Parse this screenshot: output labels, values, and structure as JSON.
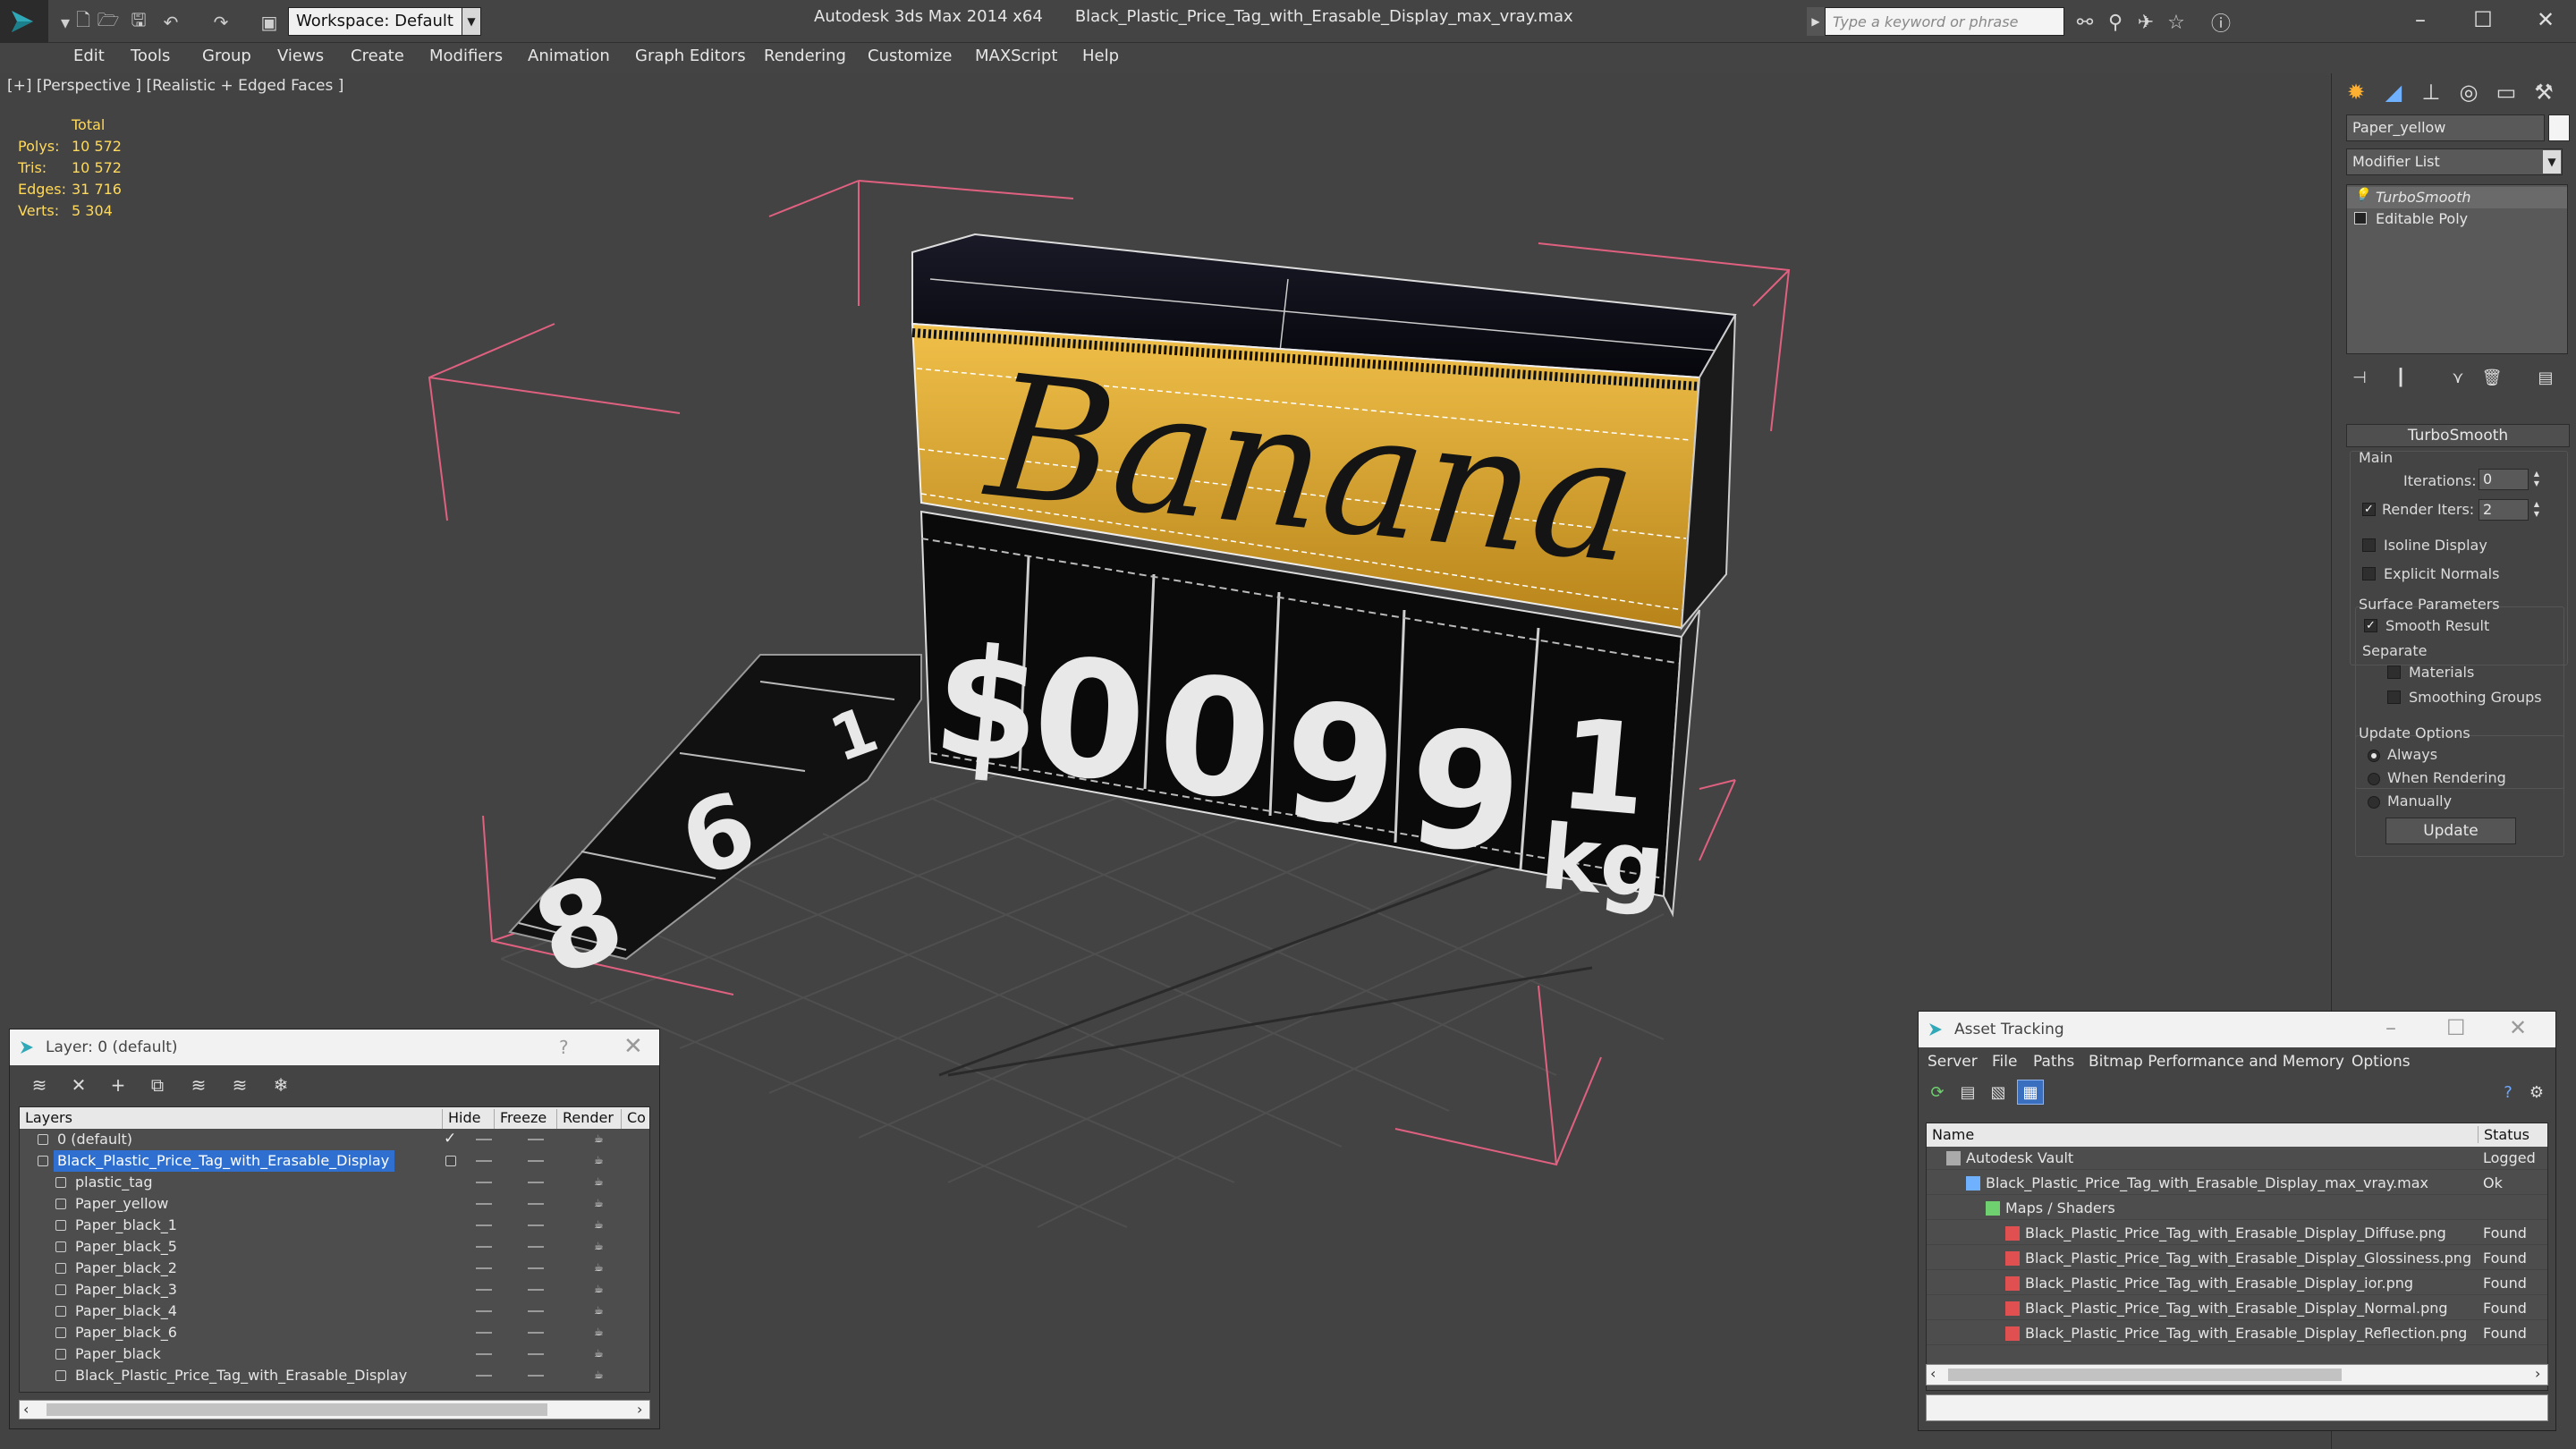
{
  "titlebar": {
    "app_title": "Autodesk 3ds Max  2014 x64",
    "file_title": "Black_Plastic_Price_Tag_with_Erasable_Display_max_vray.max",
    "workspace": "Workspace: Default",
    "search_placeholder": "Type a keyword or phrase"
  },
  "menu": [
    "Edit",
    "Tools",
    "Group",
    "Views",
    "Create",
    "Modifiers",
    "Animation",
    "Graph Editors",
    "Rendering",
    "Customize",
    "MAXScript",
    "Help"
  ],
  "viewport": {
    "label": "[+] [Perspective ] [Realistic + Edged Faces ]",
    "stats": {
      "header": "Total",
      "rows": [
        {
          "k": "Polys:",
          "v": "10 572"
        },
        {
          "k": "Tris:",
          "v": "10 572"
        },
        {
          "k": "Edges:",
          "v": "31 716"
        },
        {
          "k": "Verts:",
          "v": "5 304"
        }
      ]
    },
    "tag": {
      "word": "Banana",
      "price_chars": [
        "$",
        "0",
        "0",
        "9",
        "9"
      ],
      "unit_top": "1",
      "unit_bottom": "kg",
      "strip_chars": [
        "8",
        "6",
        "1"
      ]
    }
  },
  "command_panel": {
    "object_name": "Paper_yellow",
    "modifier_list": "Modifier List",
    "stack": [
      "TurboSmooth",
      "Editable Poly"
    ],
    "rollout": "TurboSmooth",
    "main_label": "Main",
    "iterations_label": "Iterations:",
    "iterations": "0",
    "render_iters_label": "Render Iters:",
    "render_iters": "2",
    "isoline": "Isoline Display",
    "explicit_normals": "Explicit Normals",
    "surface_params": "Surface Parameters",
    "smooth_result": "Smooth Result",
    "separate": "Separate",
    "materials": "Materials",
    "smoothing_groups": "Smoothing Groups",
    "update_options": "Update Options",
    "always": "Always",
    "when_rendering": "When Rendering",
    "manually": "Manually",
    "update_btn": "Update"
  },
  "layer_dialog": {
    "title": "Layer: 0 (default)",
    "help": "?",
    "columns": [
      "Layers",
      "Hide",
      "Freeze",
      "Render",
      "Co"
    ],
    "rows": [
      {
        "name": "0 (default)",
        "indent": 0
      },
      {
        "name": "Black_Plastic_Price_Tag_with_Erasable_Display",
        "indent": 0
      },
      {
        "name": "plastic_tag",
        "indent": 1
      },
      {
        "name": "Paper_yellow",
        "indent": 1
      },
      {
        "name": "Paper_black_1",
        "indent": 1
      },
      {
        "name": "Paper_black_5",
        "indent": 1
      },
      {
        "name": "Paper_black_2",
        "indent": 1
      },
      {
        "name": "Paper_black_3",
        "indent": 1
      },
      {
        "name": "Paper_black_4",
        "indent": 1
      },
      {
        "name": "Paper_black_6",
        "indent": 1
      },
      {
        "name": "Paper_black",
        "indent": 1
      },
      {
        "name": "Black_Plastic_Price_Tag_with_Erasable_Display",
        "indent": 1
      }
    ]
  },
  "asset_dialog": {
    "title": "Asset Tracking",
    "menu": [
      "Server",
      "File",
      "Paths",
      "Bitmap Performance and Memory",
      "Options"
    ],
    "columns": [
      "Name",
      "Status"
    ],
    "rows": [
      {
        "name": "Autodesk Vault",
        "status": "Logged"
      },
      {
        "name": "Black_Plastic_Price_Tag_with_Erasable_Display_max_vray.max",
        "status": "Ok"
      },
      {
        "name": "Maps / Shaders",
        "status": ""
      },
      {
        "name": "Black_Plastic_Price_Tag_with_Erasable_Display_Diffuse.png",
        "status": "Found"
      },
      {
        "name": "Black_Plastic_Price_Tag_with_Erasable_Display_Glossiness.png",
        "status": "Found"
      },
      {
        "name": "Black_Plastic_Price_Tag_with_Erasable_Display_ior.png",
        "status": "Found"
      },
      {
        "name": "Black_Plastic_Price_Tag_with_Erasable_Display_Normal.png",
        "status": "Found"
      },
      {
        "name": "Black_Plastic_Price_Tag_with_Erasable_Display_Reflection.png",
        "status": "Found"
      }
    ]
  },
  "colors": {
    "stats_yellow": "#ffd95a",
    "selection_blue": "#2e6fcf",
    "bbox_pink": "#e06080",
    "tag_yellow": "#d9a52a"
  }
}
